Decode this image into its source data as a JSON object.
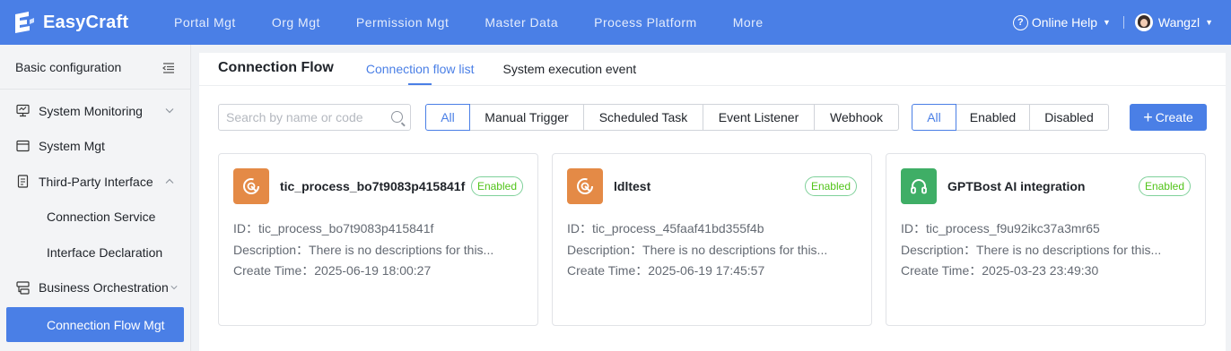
{
  "app": {
    "name": "EasyCraft"
  },
  "nav": {
    "items": [
      {
        "label": "Portal Mgt"
      },
      {
        "label": "Org Mgt"
      },
      {
        "label": "Permission Mgt"
      },
      {
        "label": "Master Data"
      },
      {
        "label": "Process Platform"
      },
      {
        "label": "More"
      }
    ],
    "help_label": "Online Help",
    "user_name": "Wangzl"
  },
  "sidebar": {
    "header": "Basic configuration",
    "items": [
      {
        "label": "System Monitoring",
        "icon": "monitor-icon"
      },
      {
        "label": "System Mgt",
        "icon": "window-icon"
      },
      {
        "label": "Third-Party Interface",
        "icon": "document-icon"
      },
      {
        "label": "Connection Service"
      },
      {
        "label": "Interface Declaration"
      },
      {
        "label": "Business Orchestration",
        "icon": "orchestration-icon"
      },
      {
        "label": "Connection Flow Mgt"
      }
    ]
  },
  "main": {
    "title": "Connection Flow",
    "tabs": [
      {
        "label": "Connection flow list"
      },
      {
        "label": "System execution event"
      }
    ],
    "search_placeholder": "Search by name or code",
    "type_filters": [
      {
        "label": "All"
      },
      {
        "label": "Manual Trigger"
      },
      {
        "label": "Scheduled Task"
      },
      {
        "label": "Event Listener"
      },
      {
        "label": "Webhook"
      }
    ],
    "status_filters": [
      {
        "label": "All"
      },
      {
        "label": "Enabled"
      },
      {
        "label": "Disabled"
      }
    ],
    "create_label": "Create"
  },
  "cards": [
    {
      "title": "tic_process_bo7t9083p415841f",
      "status": "Enabled",
      "icon": "refresh-icon",
      "icon_color": "#e48a46",
      "id_line": "ID：tic_process_bo7t9083p415841f",
      "desc_line": "Description：There is no descriptions for this...",
      "time_line": "Create Time：2025-06-19 18:00:27"
    },
    {
      "title": "ldltest",
      "status": "Enabled",
      "icon": "refresh-icon",
      "icon_color": "#e48a46",
      "id_line": "ID：tic_process_45faaf41bd355f4b",
      "desc_line": "Description：There is no descriptions for this...",
      "time_line": "Create Time：2025-06-19 17:45:57"
    },
    {
      "title": "GPTBost AI integration",
      "status": "Enabled",
      "icon": "headset-icon",
      "icon_color": "#3fae66",
      "id_line": "ID：tic_process_f9u92ikc37a3mr65",
      "desc_line": "Description：There is no descriptions for this...",
      "time_line": "Create Time：2025-03-23 23:49:30"
    }
  ],
  "colors": {
    "primary": "#4a7fe6",
    "success": "#52c41a"
  }
}
